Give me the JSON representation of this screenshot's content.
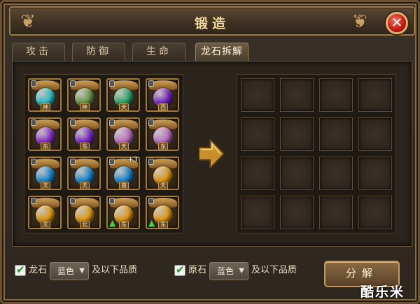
{
  "window": {
    "title": "锻造",
    "close_label": "✕"
  },
  "tabs": [
    {
      "label": "攻击",
      "active": false
    },
    {
      "label": "防御",
      "active": false
    },
    {
      "label": "生命",
      "active": false
    },
    {
      "label": "龙石拆解",
      "active": true
    }
  ],
  "inventory": [
    {
      "color": "#2cc0c8",
      "mark": "神",
      "badge": "",
      "upgrade": false
    },
    {
      "color": "#6a9a48",
      "mark": "神",
      "badge": "",
      "upgrade": false
    },
    {
      "color": "#2aa86a",
      "mark": "天",
      "badge": "",
      "upgrade": false
    },
    {
      "color": "#7a2ac8",
      "mark": "西",
      "badge": "",
      "upgrade": false
    },
    {
      "color": "#8a30d0",
      "mark": "东",
      "badge": "",
      "upgrade": false
    },
    {
      "color": "#7a2ac8",
      "mark": "东",
      "badge": "",
      "upgrade": false
    },
    {
      "color": "#c070c8",
      "mark": "天",
      "badge": "",
      "upgrade": false
    },
    {
      "color": "#c070c8",
      "mark": "东",
      "badge": "",
      "upgrade": false
    },
    {
      "color": "#1a8ad0",
      "mark": "天",
      "badge": "",
      "upgrade": false
    },
    {
      "color": "#1a8ad0",
      "mark": "天",
      "badge": "",
      "upgrade": false
    },
    {
      "color": "#1a8ad0",
      "mark": "南",
      "badge": "+3",
      "upgrade": false
    },
    {
      "color": "#e09a10",
      "mark": "天",
      "badge": "",
      "upgrade": false
    },
    {
      "color": "#e09a10",
      "mark": "天",
      "badge": "",
      "upgrade": false
    },
    {
      "color": "#e09a10",
      "mark": "北",
      "badge": "",
      "upgrade": false
    },
    {
      "color": "#e09a10",
      "mark": "东",
      "badge": "",
      "upgrade": true
    },
    {
      "color": "#e09a10",
      "mark": "东",
      "badge": "",
      "upgrade": true
    }
  ],
  "filters": {
    "dragon": {
      "label": "龙石",
      "select": "蓝色",
      "suffix": "及以下品质"
    },
    "raw": {
      "label": "原石",
      "select": "蓝色",
      "suffix": "及以下品质"
    }
  },
  "decompose_button": "分解",
  "watermark": "酷乐米"
}
